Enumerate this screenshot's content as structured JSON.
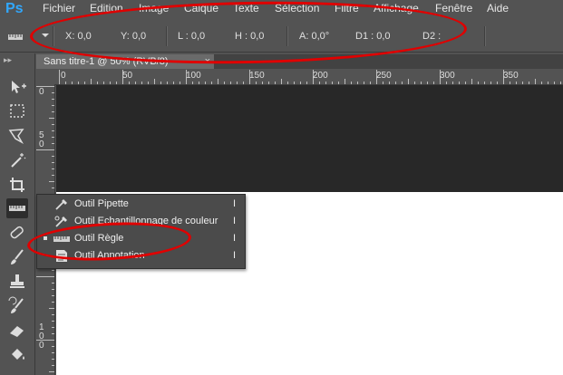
{
  "app": {
    "logo": "Ps"
  },
  "menu": {
    "items": [
      "Fichier",
      "Edition",
      "Image",
      "Calque",
      "Texte",
      "Sélection",
      "Filtre",
      "Affichage",
      "Fenêtre",
      "Aide"
    ]
  },
  "options_bar": {
    "x": "X: 0,0",
    "y": "Y: 0,0",
    "l": "L :  0,0",
    "h": "H :  0,0",
    "a": "A:  0,0°",
    "d1": "D1 :  0,0",
    "d2": "D2 :"
  },
  "document": {
    "tab_title": "Sans titre-1 @ 50% (RVB/8)",
    "close_glyph": "×"
  },
  "rulers": {
    "horizontal": [
      "0",
      "50",
      "100",
      "150",
      "200",
      "250",
      "300",
      "350"
    ],
    "vertical": [
      "0",
      "5\n0",
      "1\n0\n0"
    ]
  },
  "flyout": {
    "items": [
      {
        "label": "Outil Pipette",
        "shortcut": "I",
        "active": false,
        "icon": "eyedropper-icon"
      },
      {
        "label": "Outil Echantillonnage de couleur",
        "shortcut": "I",
        "active": false,
        "icon": "color-sampler-icon"
      },
      {
        "label": "Outil Règle",
        "shortcut": "I",
        "active": true,
        "icon": "ruler-icon"
      },
      {
        "label": "Outil Annotation",
        "shortcut": "I",
        "active": false,
        "icon": "note-icon"
      }
    ]
  },
  "colors": {
    "chrome": "#535353",
    "canvas_dark": "#282828",
    "canvas_white": "#ffffff",
    "annotation": "#e00000",
    "logo": "#31a8ff"
  }
}
